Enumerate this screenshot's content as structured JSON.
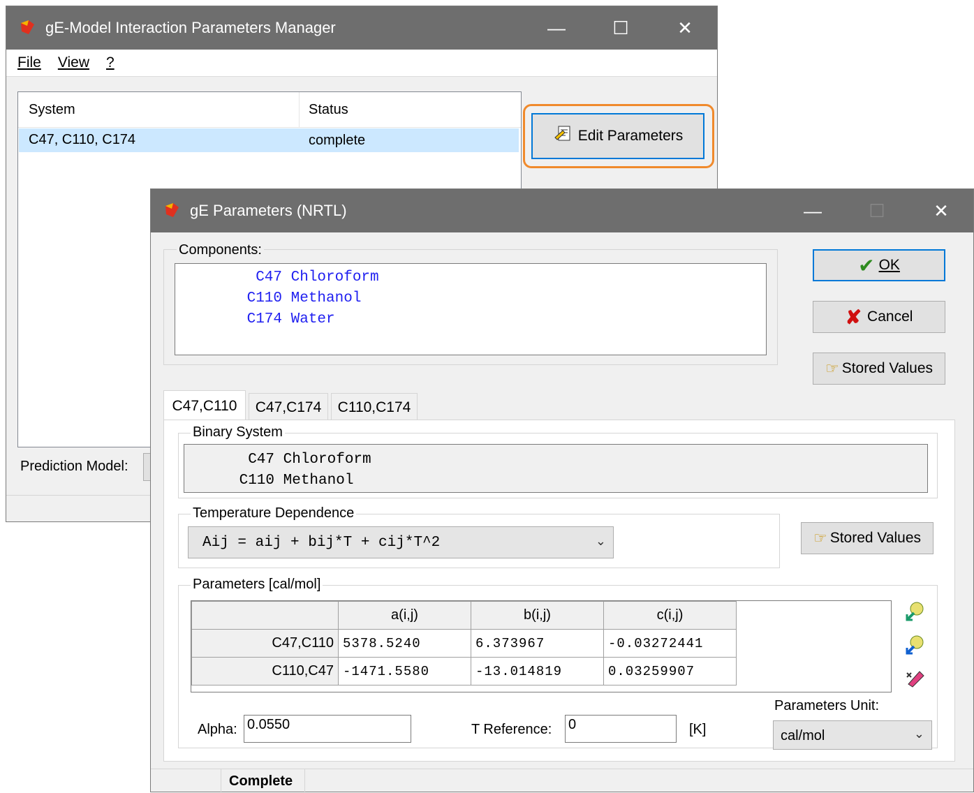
{
  "main_window": {
    "title": "gE-Model Interaction Parameters Manager",
    "caption_min": "—",
    "caption_max": "☐",
    "caption_close": "✕",
    "menu": {
      "file": "File",
      "view": "View",
      "help": "?"
    },
    "list": {
      "col_system": "System",
      "col_status": "Status",
      "rows": [
        {
          "system": "C47, C110, C174",
          "status": "complete"
        }
      ]
    },
    "edit_button": "Edit Parameters",
    "prediction_model_label": "Prediction Model:"
  },
  "dialog": {
    "title": "gE Parameters (NRTL)",
    "components_label": "Components:",
    "components": [
      "  C47 Chloroform",
      " C110 Methanol",
      " C174 Water"
    ],
    "ok_label": "OK",
    "cancel_label": "Cancel",
    "stored_values_label": "Stored Values",
    "tabs": [
      "C47,C110",
      "C47,C174",
      "C110,C174"
    ],
    "binary_system_label": "Binary System",
    "binary_system": [
      "  C47 Chloroform",
      " C110 Methanol"
    ],
    "temp_dependence_label": "Temperature Dependence",
    "temp_dependence_value": "Aij = aij + bij*T + cij*T^2",
    "stored_values_label_2": "Stored Values",
    "parameters_label": "Parameters [cal/mol]",
    "table": {
      "headers": [
        "a(i,j)",
        "b(i,j)",
        "c(i,j)"
      ],
      "rows": [
        {
          "label": "C47,C110",
          "a": "5378.5240",
          "b": "6.373967",
          "c": "-0.03272441"
        },
        {
          "label": "C110,C47",
          "a": "-1471.5580",
          "b": "-13.014819",
          "c": "0.03259907"
        }
      ]
    },
    "alpha_label": "Alpha:",
    "alpha_value": "0.0550",
    "tref_label": "T Reference:",
    "tref_value": "0",
    "tref_unit": "[K]",
    "param_unit_label": "Parameters Unit:",
    "param_unit_value": "cal/mol",
    "status_text": "Complete"
  },
  "colors": {
    "accent_highlight": "#f08a2c",
    "component_text": "#1e1ef0",
    "selection": "#cce8ff"
  }
}
